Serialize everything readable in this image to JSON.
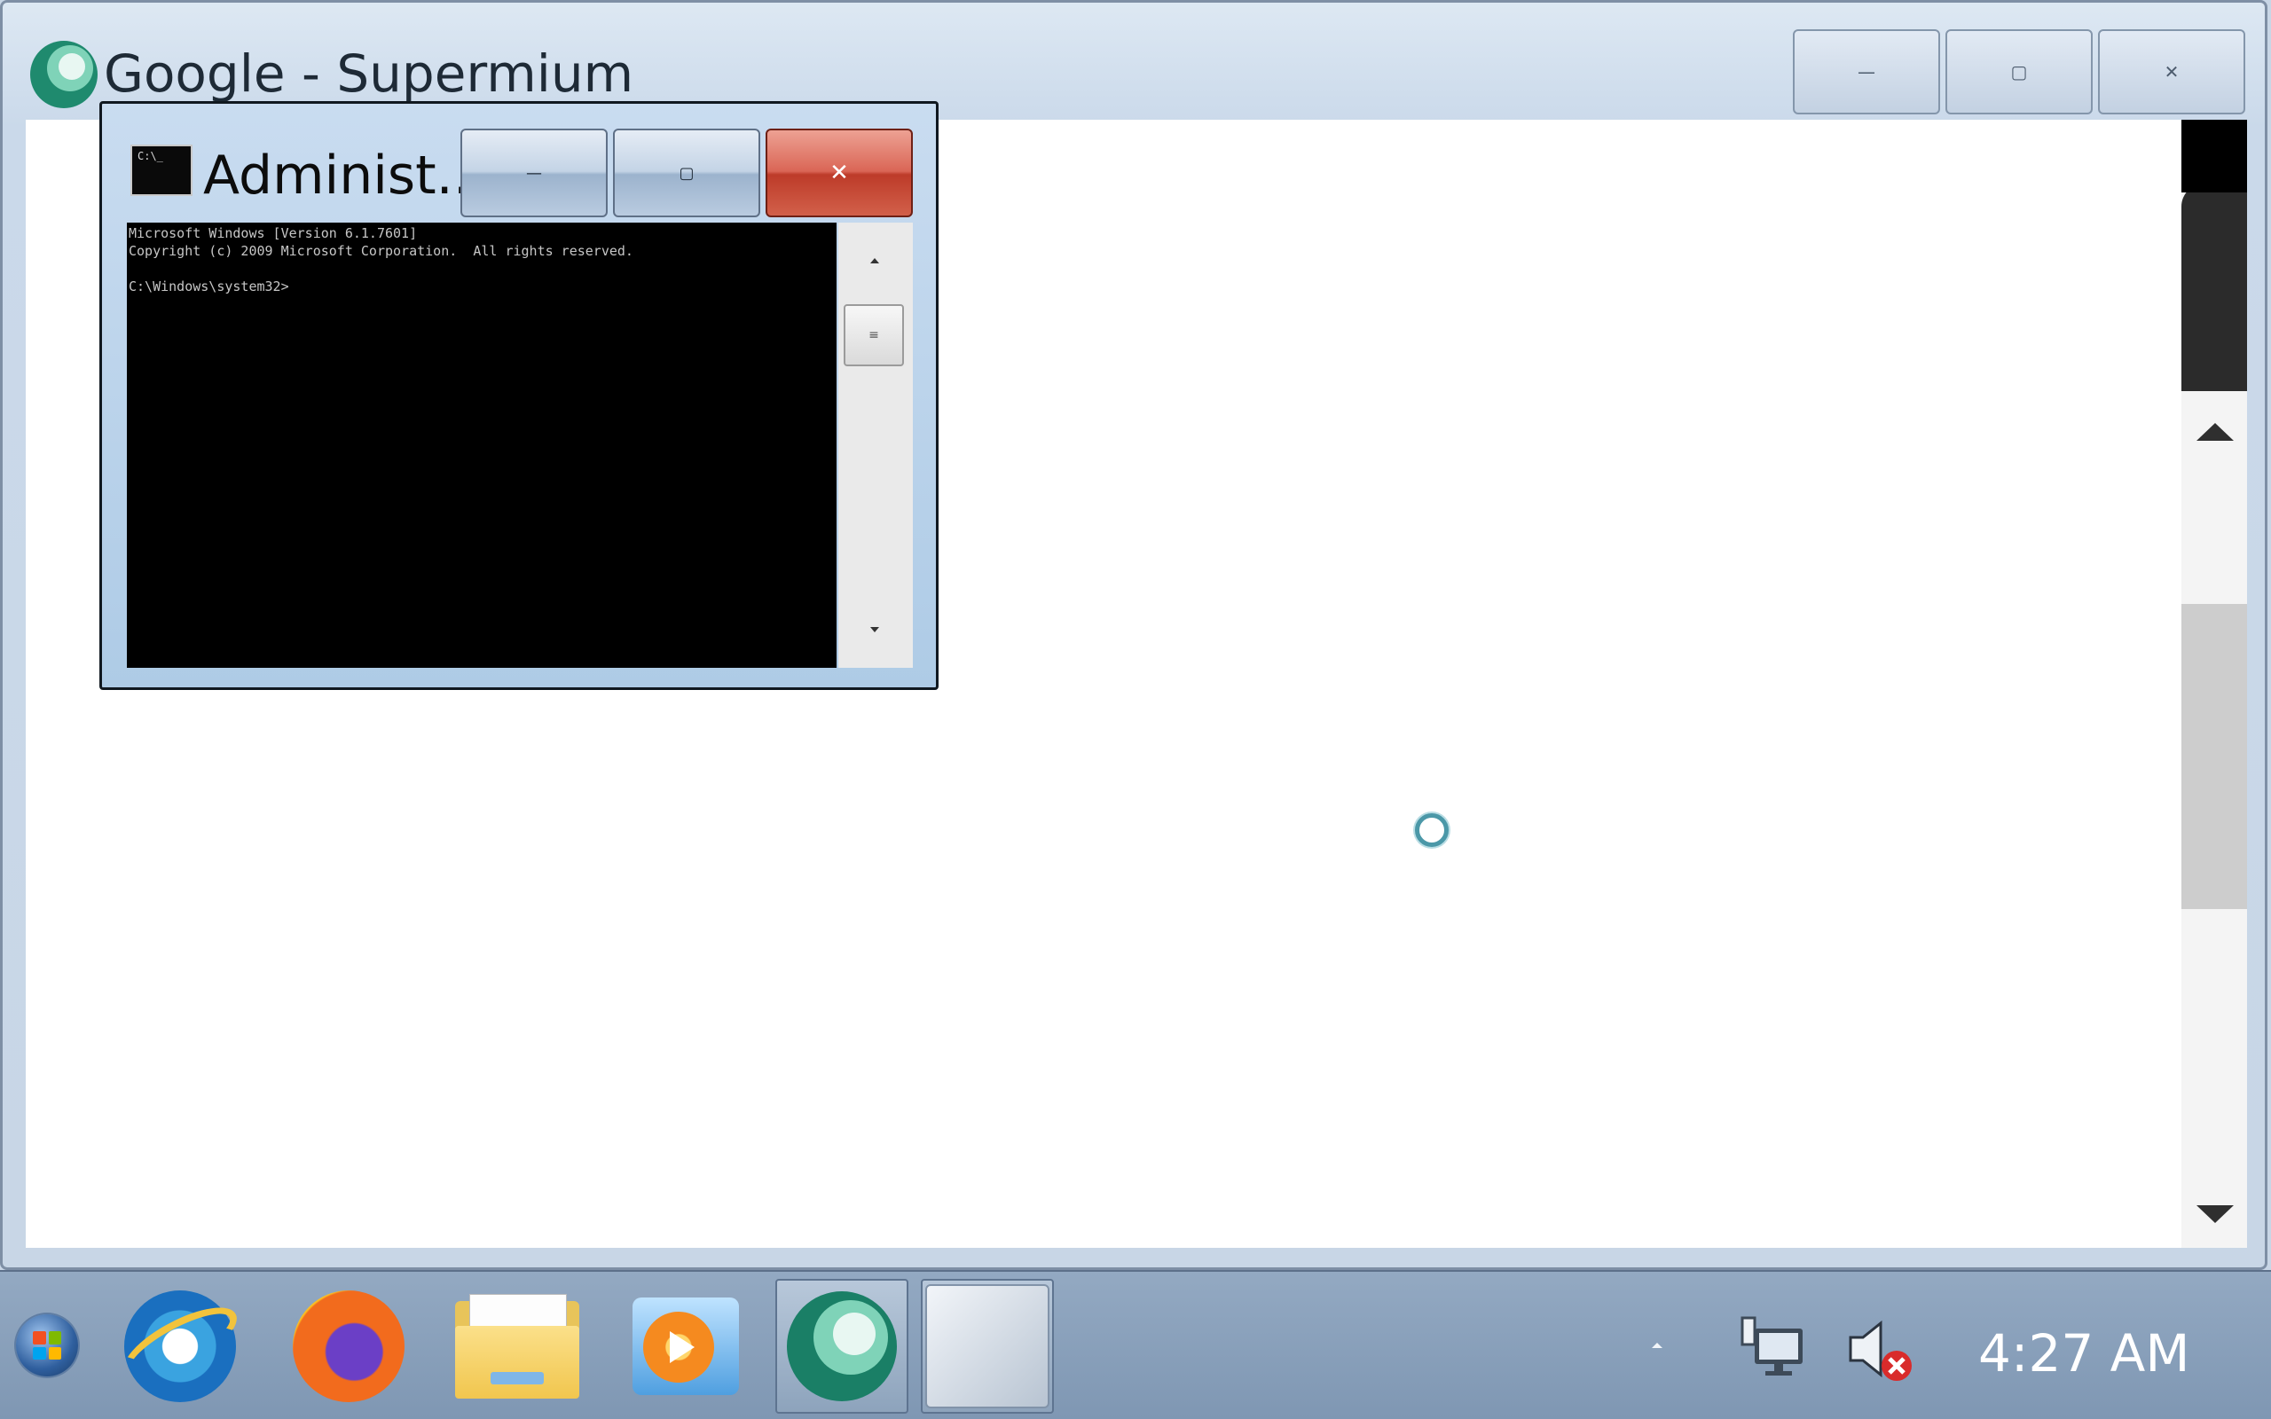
{
  "browser": {
    "title": "Google - Supermium",
    "controls": {
      "minimize": "—",
      "maximize": "▢",
      "close": "✕"
    },
    "logo_icon": "supermium-logo-icon",
    "loading_icon": "loading-spinner-icon"
  },
  "cmd": {
    "title": "Administ...",
    "icon_text": "C:\\_",
    "controls": {
      "minimize": "—",
      "maximize": "▢",
      "close": "✕"
    },
    "console_text": "Microsoft Windows [Version 6.1.7601]\nCopyright (c) 2009 Microsoft Corporation.  All rights reserved.\n\nC:\\Windows\\system32>",
    "scroll_thumb_grip": "≡"
  },
  "taskbar": {
    "items": [
      {
        "name": "start-button",
        "icon": "windows-logo-icon"
      },
      {
        "name": "internet-explorer",
        "icon": "internet-explorer-icon"
      },
      {
        "name": "firefox",
        "icon": "firefox-icon"
      },
      {
        "name": "file-explorer",
        "icon": "folder-icon"
      },
      {
        "name": "media-player",
        "icon": "media-player-icon"
      },
      {
        "name": "supermium",
        "icon": "supermium-icon",
        "active": true
      },
      {
        "name": "command-prompt",
        "icon": "blank-window-icon",
        "active": true
      }
    ],
    "tray": {
      "network_icon": "network-icon",
      "volume_icon": "volume-muted-icon",
      "clock": "4:27 AM"
    }
  },
  "colors": {
    "close_red": "#c74331",
    "taskbar_blue": "#8aa0ba",
    "console_bg": "#000000"
  }
}
